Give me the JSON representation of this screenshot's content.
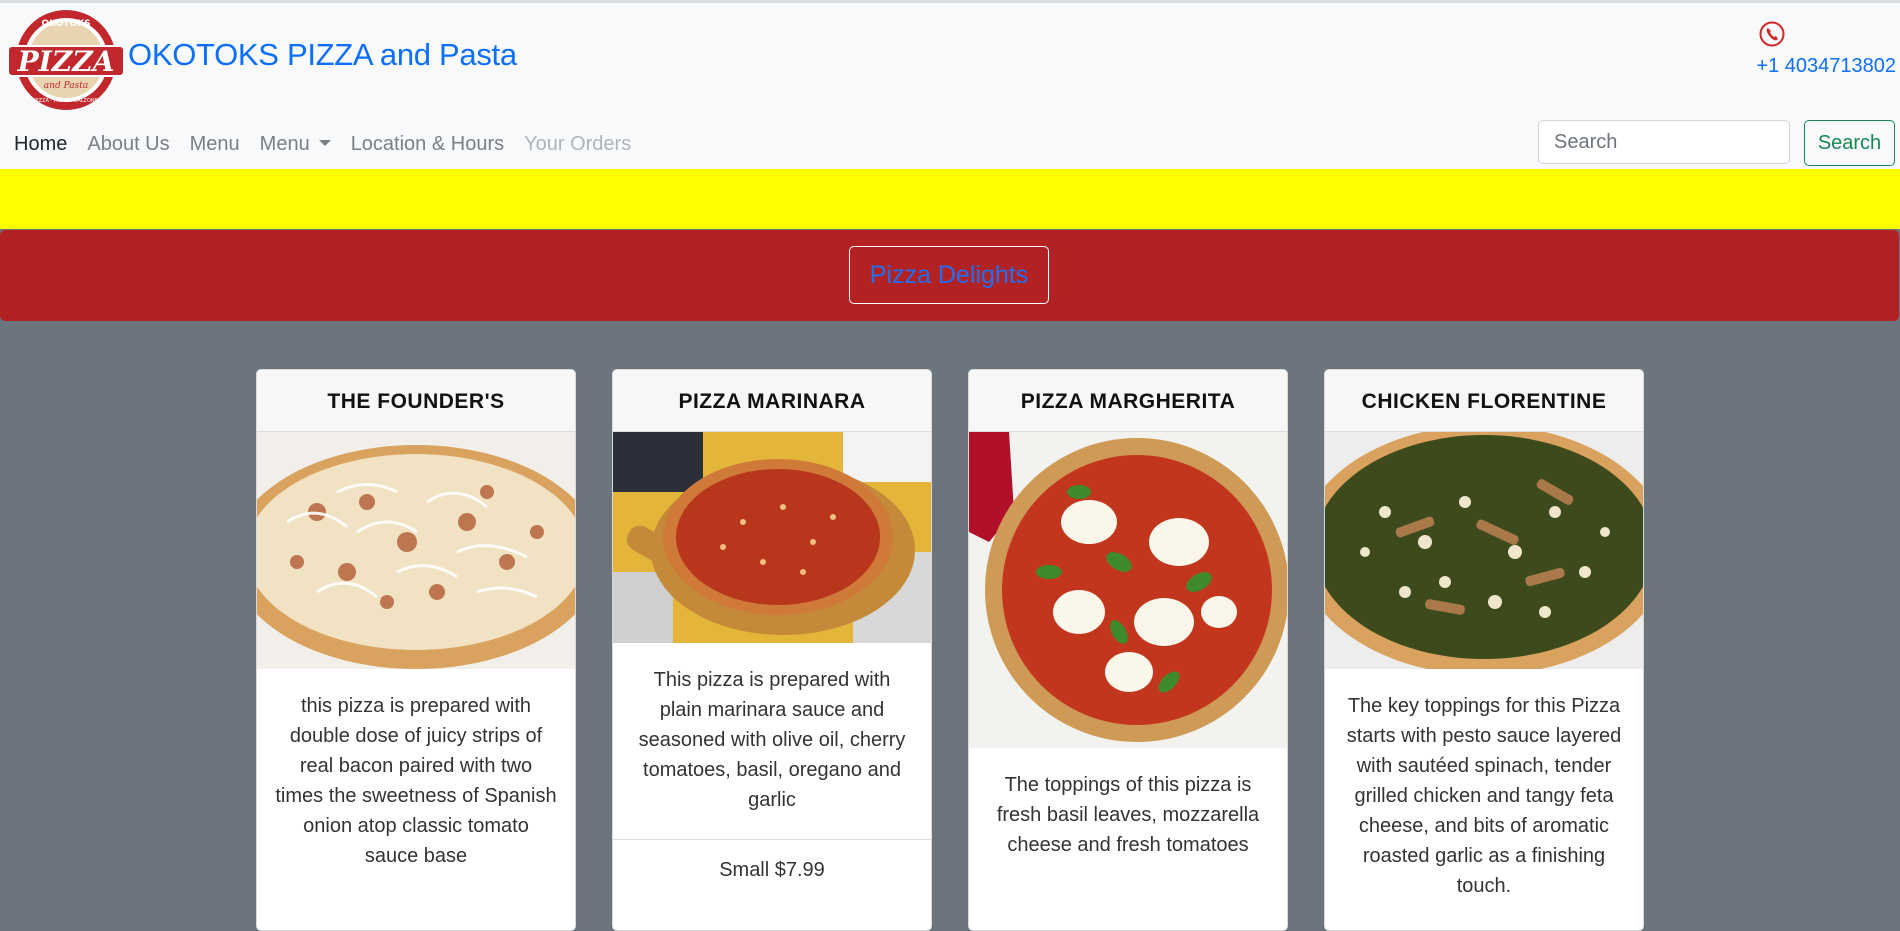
{
  "brand": {
    "name_part1": "OKOTOKS PIZZA",
    "name_part2": " and Pasta",
    "logo_text": {
      "arc": "OKOTOKS",
      "main": "PIZZA",
      "sub": "and Pasta",
      "bottom": "PIZZA · PASTA · CALZONE"
    }
  },
  "contact": {
    "phone": "+1 4034713802",
    "icon": "phone-icon"
  },
  "nav": {
    "home": "Home",
    "about": "About Us",
    "menu": "Menu",
    "menu_dropdown": "Menu",
    "location": "Location & Hours",
    "orders": "Your Orders"
  },
  "search": {
    "placeholder": "Search",
    "button": "Search"
  },
  "section": {
    "title": "Pizza Delights"
  },
  "colors": {
    "accent": "#0d6efd",
    "red_band": "#b22222",
    "yellow_band": "#ffff00",
    "page_bg": "#6c757d",
    "search_green": "#198754"
  },
  "cards": [
    {
      "title": "THE FOUNDER'S",
      "description": "this pizza is prepared with double dose of juicy strips of real bacon paired with two times the sweetness of Spanish onion atop classic tomato sauce base",
      "price": ""
    },
    {
      "title": "PIZZA MARINARA",
      "description": "This pizza is prepared with plain marinara sauce and seasoned with olive oil, cherry tomatoes, basil, oregano and garlic",
      "price": "Small $7.99"
    },
    {
      "title": "PIZZA MARGHERITA",
      "description": "The toppings of this pizza is fresh basil leaves, mozzarella cheese and fresh tomatoes",
      "price": ""
    },
    {
      "title": "CHICKEN FLORENTINE",
      "description": "The key toppings for this Pizza starts with pesto sauce layered with sautéed spinach, tender grilled chicken and tangy feta cheese, and bits of aromatic roasted garlic as a finishing touch.",
      "price": ""
    }
  ]
}
